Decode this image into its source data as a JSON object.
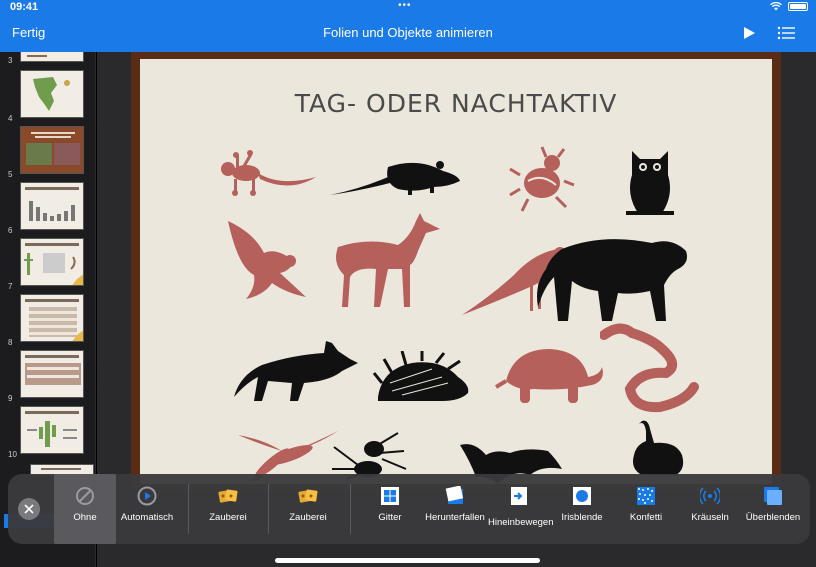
{
  "status": {
    "time": "09:41"
  },
  "nav": {
    "done": "Fertig",
    "title": "Folien und Objekte animieren"
  },
  "sidebar": {
    "slides": [
      {
        "number": "3"
      },
      {
        "number": "4"
      },
      {
        "number": "5"
      },
      {
        "number": "6"
      },
      {
        "number": "7"
      },
      {
        "number": "8"
      },
      {
        "number": "9"
      },
      {
        "number": "10"
      }
    ]
  },
  "slide": {
    "title": "TAG- ODER NACHTAKTIV"
  },
  "animals": [
    {
      "name": "gecko",
      "color": "#b5605a"
    },
    {
      "name": "rat",
      "color": "#111111"
    },
    {
      "name": "beetle",
      "color": "#b5605a"
    },
    {
      "name": "owl",
      "color": "#111111"
    },
    {
      "name": "hawk",
      "color": "#b5605a"
    },
    {
      "name": "deer",
      "color": "#b5605a"
    },
    {
      "name": "magpie",
      "color": "#b5605a"
    },
    {
      "name": "panther",
      "color": "#111111"
    },
    {
      "name": "fox",
      "color": "#111111"
    },
    {
      "name": "porcupine",
      "color": "#111111"
    },
    {
      "name": "turtle",
      "color": "#b5605a"
    },
    {
      "name": "snake",
      "color": "#b5605a"
    },
    {
      "name": "dragonfly",
      "color": "#b5605a"
    },
    {
      "name": "spider",
      "color": "#111111"
    },
    {
      "name": "bat",
      "color": "#111111"
    },
    {
      "name": "rabbit",
      "color": "#111111"
    }
  ],
  "transitions": {
    "options": [
      {
        "label": "Ohne",
        "icon": "none-icon",
        "selected": true
      },
      {
        "label": "Automatisch",
        "icon": "play-circle-icon"
      },
      {
        "label": "Zauberei",
        "icon": "magic-move-icon"
      },
      {
        "label": "Zauberei",
        "icon": "magic-move-icon"
      },
      {
        "label": "Gitter",
        "icon": "grid-icon"
      },
      {
        "label": "Herunterfallen",
        "icon": "fall-icon"
      },
      {
        "label": "Hineinbewegen",
        "icon": "move-in-icon"
      },
      {
        "label": "Irisblende",
        "icon": "iris-icon"
      },
      {
        "label": "Konfetti",
        "icon": "confetti-icon"
      },
      {
        "label": "Kräuseln",
        "icon": "ripple-icon"
      },
      {
        "label": "Überblenden",
        "icon": "dissolve-icon"
      }
    ]
  },
  "colors": {
    "accent": "#1a7be8",
    "frame": "#5a2c14",
    "slide_bg": "#ece7dd",
    "day": "#b5605a",
    "night": "#111111"
  }
}
